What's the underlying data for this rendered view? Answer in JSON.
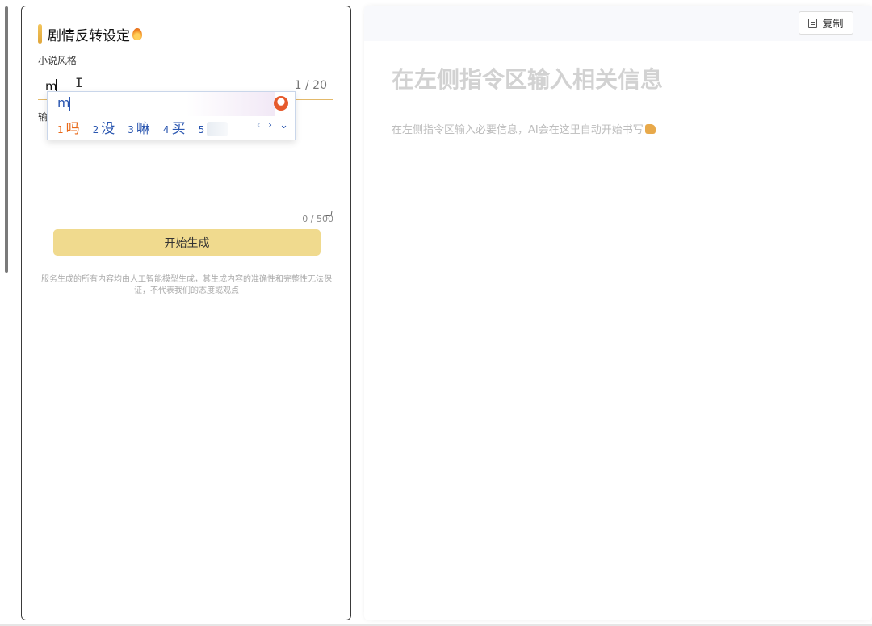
{
  "left_panel": {
    "title": "剧情反转设定",
    "style_field": {
      "label": "小说风格",
      "value": "m",
      "counter": "1 / 20"
    },
    "second_field": {
      "label": "输",
      "counter": "0 / 500"
    },
    "generate_button": "开始生成",
    "disclaimer": "服务生成的所有内容均由人工智能模型生成，其生成内容的准确性和完整性无法保证，不代表我们的态度或观点"
  },
  "ime": {
    "composition": "m",
    "candidates": [
      {
        "num": "1",
        "text": "吗"
      },
      {
        "num": "2",
        "text": "没"
      },
      {
        "num": "3",
        "text": "嘛"
      },
      {
        "num": "4",
        "text": "买"
      },
      {
        "num": "5",
        "text": ""
      }
    ],
    "nav_prev": "‹",
    "nav_next": "›",
    "nav_expand": "⌄"
  },
  "right_panel": {
    "copy_button": "复制",
    "placeholder_title": "在左侧指令区输入相关信息",
    "placeholder_subtitle": "在左侧指令区输入必要信息，AI会在这里自动开始书写"
  },
  "icons": {
    "flame": "flame-icon",
    "copy": "copy-icon",
    "hand": "writing-hand-icon",
    "ime_logo": "ime-logo-icon"
  },
  "colors": {
    "accent": "#f0da8e",
    "title_bar": "#e0a63a",
    "ime_text": "#2a56b0",
    "ime_first": "#e86a1a"
  }
}
